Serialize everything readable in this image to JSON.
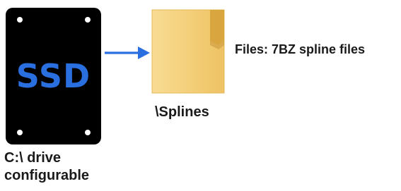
{
  "ssd": {
    "label": "SSD",
    "caption": "C:\\ drive\nconfigurable",
    "label_color": "#2a6fe0"
  },
  "connector": {
    "icon": "right-arrow-icon",
    "color": "#2a6fe0"
  },
  "folder": {
    "icon": "folder-icon",
    "caption": "\\Splines"
  },
  "files": {
    "caption": "Files: 7BZ spline files"
  }
}
